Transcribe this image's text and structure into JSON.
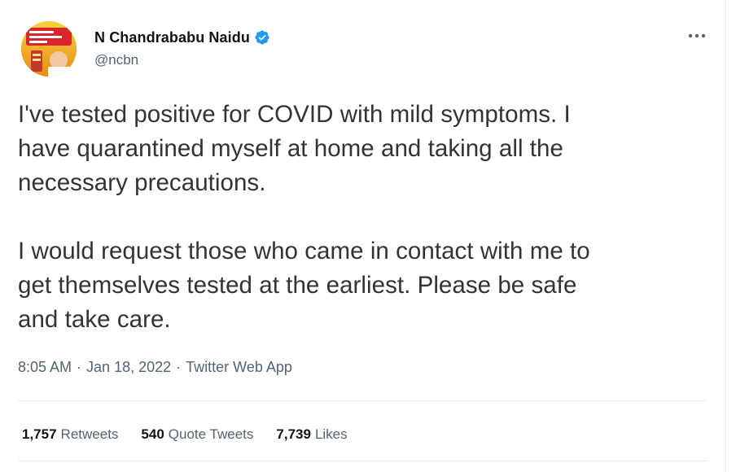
{
  "tweet": {
    "author": {
      "display_name": "N Chandrababu Naidu",
      "handle": "@ncbn",
      "verified": true,
      "verified_color": "#1d9bf0"
    },
    "paragraph_1": "I've tested positive for COVID with mild symptoms. I\nhave quarantined myself at home and taking all the\nnecessary precautions.",
    "paragraph_2": "I would request those who came in contact with me to\nget themselves tested at the earliest. Please be safe\nand take care.",
    "time": "8:05 AM",
    "separator": "·",
    "date": "Jan 18, 2022",
    "source_app": "Twitter Web App",
    "stats": {
      "retweets_count": "1,757",
      "retweets_label": "Retweets",
      "quotes_count": "540",
      "quotes_label": "Quote Tweets",
      "likes_count": "7,739",
      "likes_label": "Likes"
    }
  },
  "icons": {
    "more": "more-horizontal-icon",
    "verified": "verified-badge-icon"
  }
}
